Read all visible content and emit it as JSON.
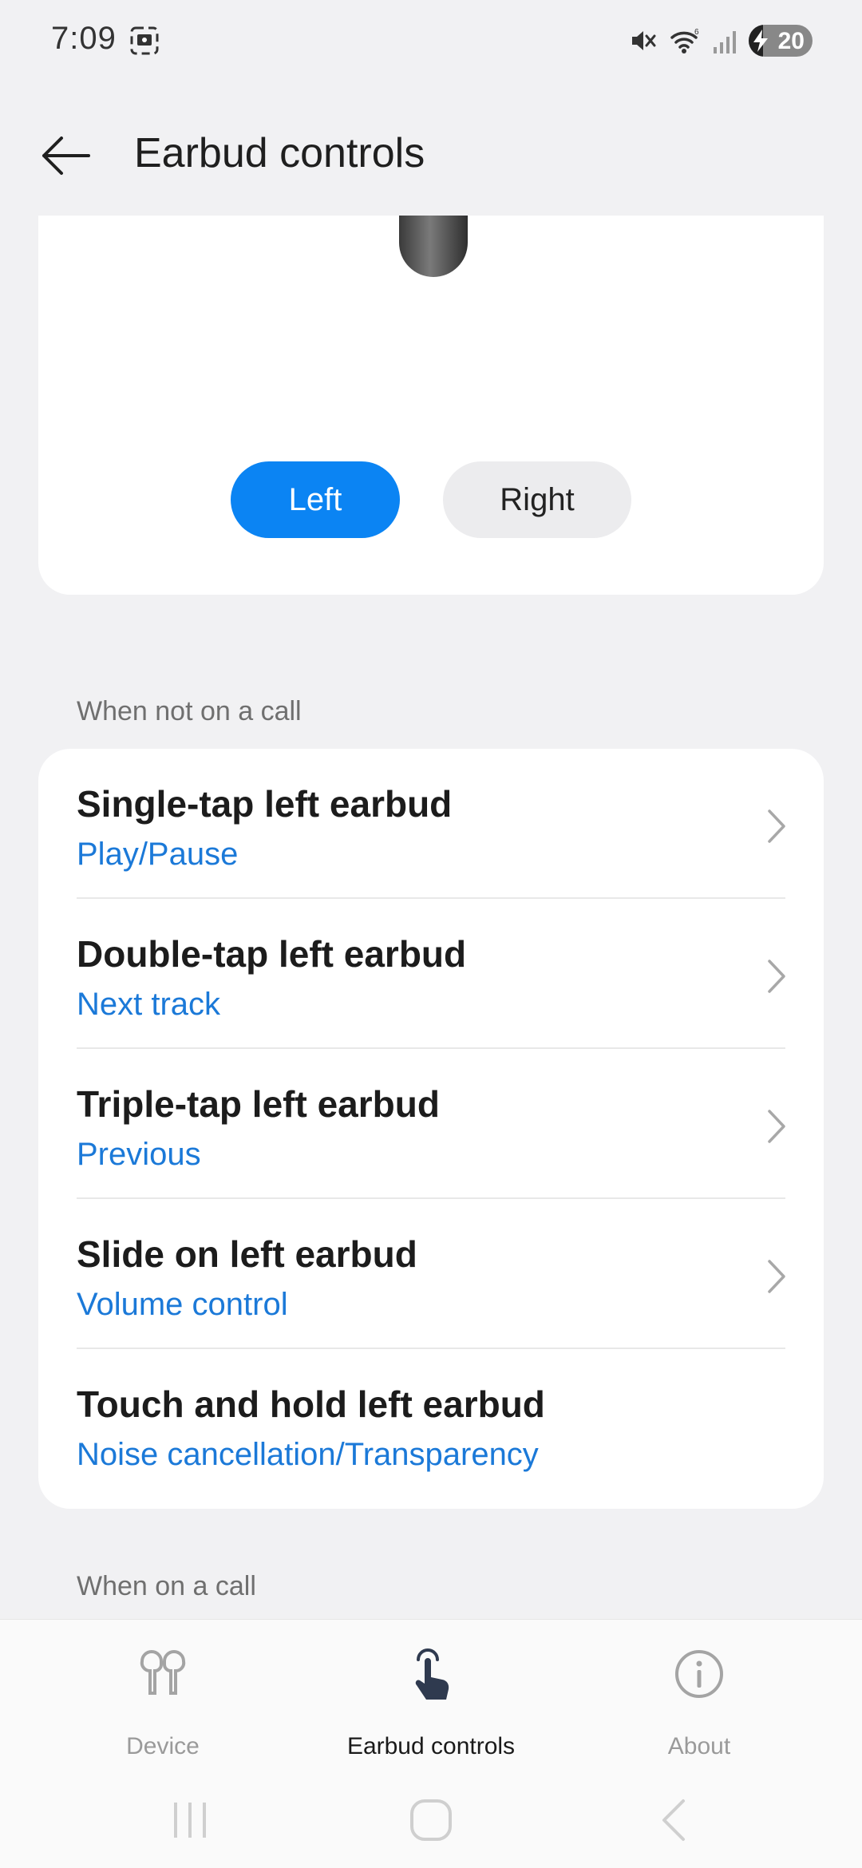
{
  "status_bar": {
    "time": "7:09",
    "battery_level": "20",
    "icons": [
      "screenshot-icon",
      "mute-icon",
      "wifi-icon",
      "signal-icon",
      "battery-icon"
    ]
  },
  "header": {
    "back_icon": "arrow-left-icon",
    "title": "Earbud controls"
  },
  "earbud_selector": {
    "left_label": "Left",
    "right_label": "Right",
    "selected": "Left",
    "accent": "#0b84f3"
  },
  "section_not_on_call": {
    "label": "When not on a call",
    "items": [
      {
        "title": "Single-tap left earbud",
        "value": "Play/Pause"
      },
      {
        "title": "Double-tap left earbud",
        "value": "Next track"
      },
      {
        "title": "Triple-tap left earbud",
        "value": "Previous"
      },
      {
        "title": "Slide on left earbud",
        "value": "Volume control"
      },
      {
        "title": "Touch and hold left earbud",
        "value": "Noise cancellation/Transparency"
      }
    ]
  },
  "section_on_call": {
    "label": "When on a call"
  },
  "bottom_nav": {
    "device_label": "Device",
    "controls_label": "Earbud controls",
    "about_label": "About",
    "active": "Earbud controls"
  },
  "colors": {
    "value_blue": "#1b79d8",
    "background": "#f1f1f3"
  }
}
